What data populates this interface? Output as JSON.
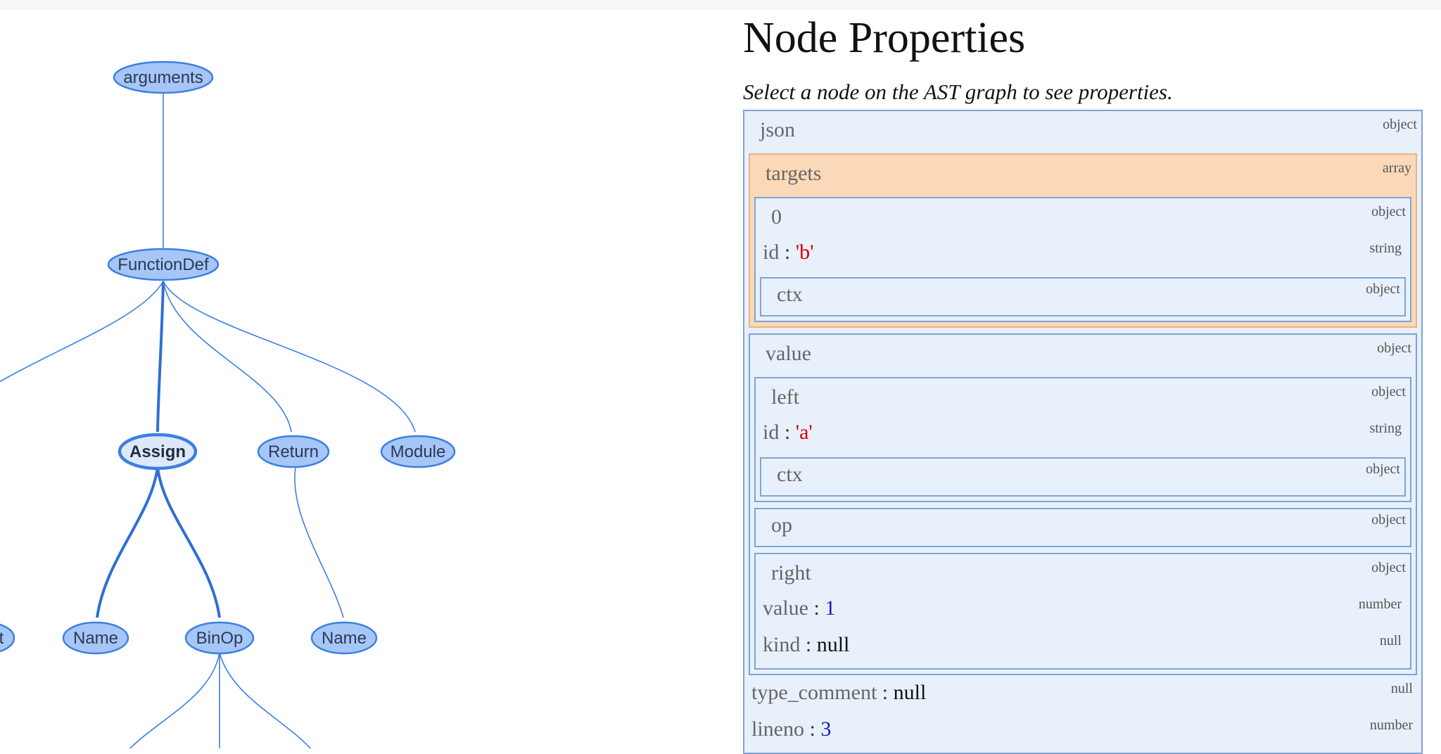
{
  "graph": {
    "nodes": [
      {
        "id": "arguments",
        "label": "arguments"
      },
      {
        "id": "functiondef",
        "label": "FunctionDef"
      },
      {
        "id": "assign",
        "label": "Assign",
        "selected": true
      },
      {
        "id": "return",
        "label": "Return"
      },
      {
        "id": "module",
        "label": "Module"
      },
      {
        "id": "partial",
        "label": "t"
      },
      {
        "id": "name1",
        "label": "Name"
      },
      {
        "id": "binop",
        "label": "BinOp"
      },
      {
        "id": "name2",
        "label": "Name"
      }
    ]
  },
  "panel": {
    "title": "Node Properties",
    "hint": "Select a node on the AST graph to see properties.",
    "json": {
      "key": "json",
      "type": "object",
      "targets": {
        "key": "targets",
        "type": "array",
        "item0": {
          "key": "0",
          "type": "object",
          "id": {
            "key": "id",
            "value": "'b'",
            "type": "string"
          },
          "ctx": {
            "key": "ctx",
            "type": "object"
          }
        }
      },
      "value": {
        "key": "value",
        "type": "object",
        "left": {
          "key": "left",
          "type": "object",
          "id": {
            "key": "id",
            "value": "'a'",
            "type": "string"
          },
          "ctx": {
            "key": "ctx",
            "type": "object"
          }
        },
        "op": {
          "key": "op",
          "type": "object"
        },
        "right": {
          "key": "right",
          "type": "object",
          "value": {
            "key": "value",
            "value": "1",
            "type": "number"
          },
          "kind": {
            "key": "kind",
            "value": "null",
            "type": "null"
          }
        }
      },
      "type_comment": {
        "key": "type_comment",
        "value": "null",
        "type": "null"
      },
      "lineno": {
        "key": "lineno",
        "value": "3",
        "type": "number"
      }
    }
  }
}
